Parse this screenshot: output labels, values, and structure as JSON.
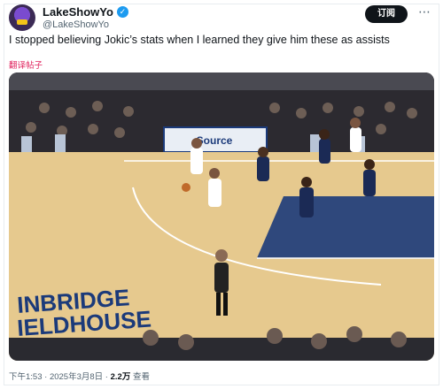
{
  "author": {
    "display_name": "LakeShowYo",
    "handle": "@LakeShowYo",
    "verified_icon": "verified-badge-icon",
    "avatar_icon": "avatar-icon"
  },
  "header": {
    "follow_label": "订阅",
    "more_icon": "more-icon"
  },
  "tweet": {
    "text": "I stopped believing Jokic’s stats when I learned they give him these as assists",
    "translate_label": "翻译帖子"
  },
  "media": {
    "type": "video-still",
    "arena_text_line1": "INBRIDGE",
    "arena_text_line2": "IELDHOUSE",
    "board_text": "Source"
  },
  "meta": {
    "time": "下午1:53",
    "date": "2025年3月8日",
    "separator": "·",
    "views": "2.2万",
    "views_label": "查看"
  },
  "colors": {
    "accent_blue": "#1d9bf0",
    "court": "#e6c98e",
    "paint": "#1b3a7a",
    "text": "#0f1419",
    "muted": "#536471"
  }
}
